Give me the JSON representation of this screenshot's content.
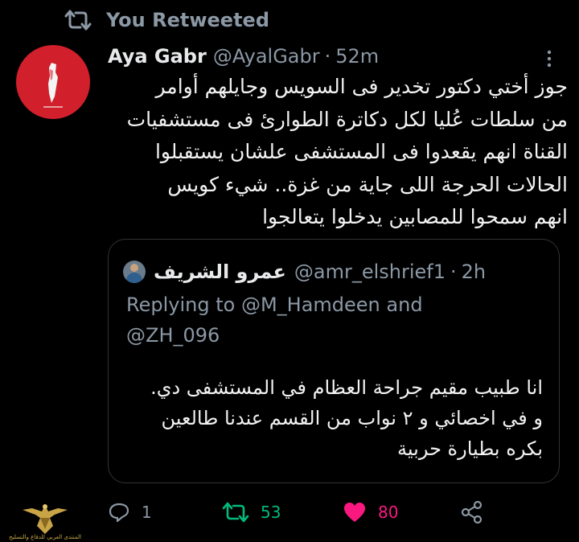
{
  "retweet_banner": {
    "label": "You Retweeted",
    "icon": "retweet-icon"
  },
  "tweet": {
    "author_name": "Aya Gabr",
    "author_handle": "@AyalGabr",
    "separator": "·",
    "time": "52m",
    "more_icon": "more-vertical-icon",
    "avatar_icon": "palestine-map-icon",
    "avatar_color": "#d11f2b",
    "body_lines": [
      "جوز أختي دكتور تخدير فى السويس وجايلهم أوامر",
      "من سلطات عُليا لكل دكاترة الطوارئ فى مستشفيات",
      "القناة انهم يقعدوا فى المستشفى علشان يستقبلوا",
      "الحالات الحرجة اللى جاية من غزة.. شيء كويس",
      "انهم سمحوا للمصابين يدخلوا يتعالجوا"
    ]
  },
  "quoted_tweet": {
    "author_name": "عمرو الشريف",
    "author_handle": "@amr_elshrief1",
    "separator": "·",
    "time": "2h",
    "replying_prefix": "Replying to",
    "replying_mention_1": "@M_Hamdeen",
    "replying_and": "and",
    "replying_mention_2": "@ZH_096",
    "body_lines": [
      "انا طبيب مقيم جراحة العظام في المستشفى دي.",
      "و في اخصائي و ٢ نواب من القسم عندنا طالعين",
      "بكره بطيارة حربية"
    ]
  },
  "actions": {
    "reply_count": "1",
    "retweet_count": "53",
    "like_count": "80",
    "retweet_color": "#00ba7c",
    "like_color": "#f91880",
    "muted_color": "#8b98a5"
  },
  "watermark": {
    "text": "المنتدى العربي للدفاع والتسليح",
    "icon": "eagle-emblem-icon"
  }
}
